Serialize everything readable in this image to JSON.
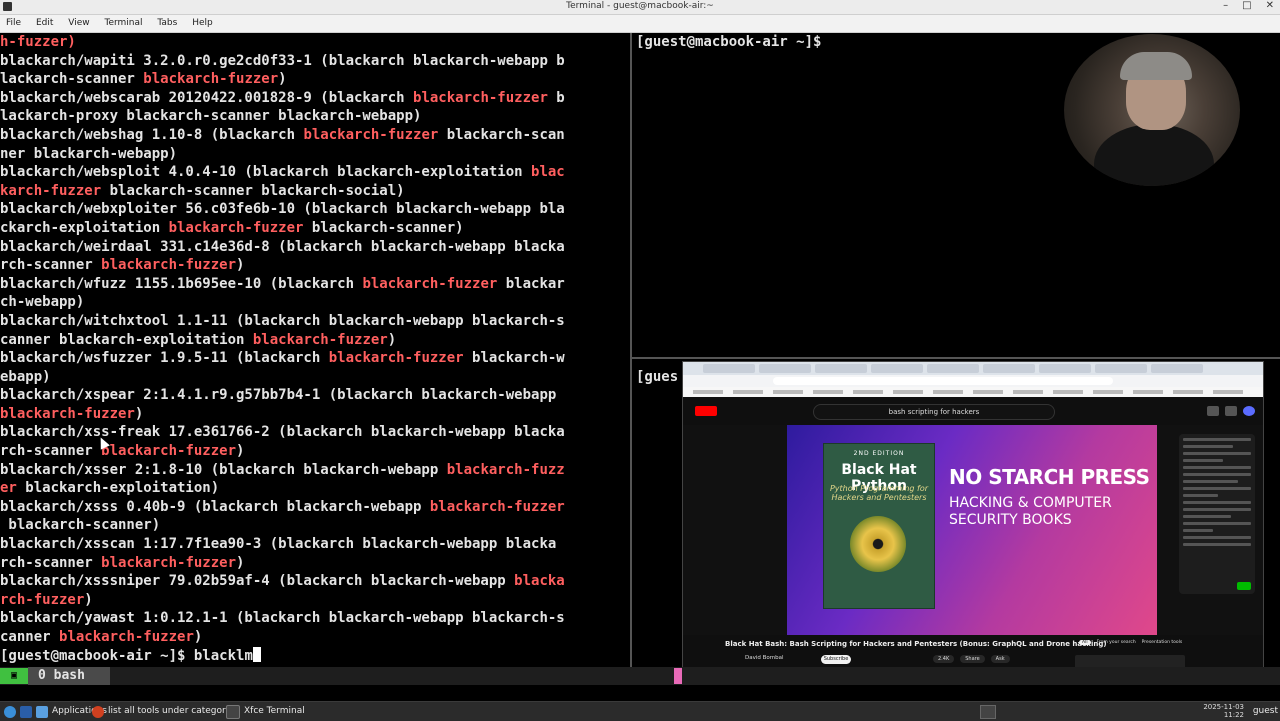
{
  "window": {
    "title": "Terminal - guest@macbook-air:~",
    "minimize": "–",
    "maximize": "□",
    "close": "✕"
  },
  "menu": [
    "File",
    "Edit",
    "View",
    "Terminal",
    "Tabs",
    "Help"
  ],
  "terminal_left": {
    "lines": [
      [
        {
          "t": "h-fuzzer)",
          "c": "r"
        }
      ],
      [
        {
          "t": "blackarch/wapiti 3.2.0.r0.ge2cd0f33-1 (blackarch blackarch-webapp b"
        }
      ],
      [
        {
          "t": "lackarch-scanner "
        },
        {
          "t": "blackarch-fuzzer",
          "c": "r"
        },
        {
          "t": ")"
        }
      ],
      [
        {
          "t": "blackarch/webscarab 20120422.001828-9 (blackarch "
        },
        {
          "t": "blackarch-fuzzer",
          "c": "r"
        },
        {
          "t": " b"
        }
      ],
      [
        {
          "t": "lackarch-proxy blackarch-scanner blackarch-webapp)"
        }
      ],
      [
        {
          "t": "blackarch/webshag 1.10-8 (blackarch "
        },
        {
          "t": "blackarch-fuzzer",
          "c": "r"
        },
        {
          "t": " blackarch-scan"
        }
      ],
      [
        {
          "t": "ner blackarch-webapp)"
        }
      ],
      [
        {
          "t": "blackarch/websploit 4.0.4-10 (blackarch blackarch-exploitation "
        },
        {
          "t": "blac",
          "c": "r"
        }
      ],
      [
        {
          "t": "karch-fuzzer",
          "c": "r"
        },
        {
          "t": " blackarch-scanner blackarch-social)"
        }
      ],
      [
        {
          "t": "blackarch/webxploiter 56.c03fe6b-10 (blackarch blackarch-webapp bla"
        }
      ],
      [
        {
          "t": "ckarch-exploitation "
        },
        {
          "t": "blackarch-fuzzer",
          "c": "r"
        },
        {
          "t": " blackarch-scanner)"
        }
      ],
      [
        {
          "t": "blackarch/weirdaal 331.c14e36d-8 (blackarch blackarch-webapp blacka"
        }
      ],
      [
        {
          "t": "rch-scanner "
        },
        {
          "t": "blackarch-fuzzer",
          "c": "r"
        },
        {
          "t": ")"
        }
      ],
      [
        {
          "t": "blackarch/wfuzz 1155.1b695ee-10 (blackarch "
        },
        {
          "t": "blackarch-fuzzer",
          "c": "r"
        },
        {
          "t": " blackar"
        }
      ],
      [
        {
          "t": "ch-webapp)"
        }
      ],
      [
        {
          "t": "blackarch/witchxtool 1.1-11 (blackarch blackarch-webapp blackarch-s"
        }
      ],
      [
        {
          "t": "canner blackarch-exploitation "
        },
        {
          "t": "blackarch-fuzzer",
          "c": "r"
        },
        {
          "t": ")"
        }
      ],
      [
        {
          "t": "blackarch/wsfuzzer 1.9.5-11 (blackarch "
        },
        {
          "t": "blackarch-fuzzer",
          "c": "r"
        },
        {
          "t": " blackarch-w"
        }
      ],
      [
        {
          "t": "ebapp)"
        }
      ],
      [
        {
          "t": "blackarch/xspear 2:1.4.1.r9.g57bb7b4-1 (blackarch blackarch-webapp"
        }
      ],
      [
        {
          "t": "blackarch-fuzzer",
          "c": "r"
        },
        {
          "t": ")"
        }
      ],
      [
        {
          "t": "blackarch/xss-freak 17.e361766-2 (blackarch blackarch-webapp blacka"
        }
      ],
      [
        {
          "t": "rch-scanner "
        },
        {
          "t": "blackarch-fuzzer",
          "c": "r"
        },
        {
          "t": ")"
        }
      ],
      [
        {
          "t": "blackarch/xsser 2:1.8-10 (blackarch blackarch-webapp "
        },
        {
          "t": "blackarch-fuzz",
          "c": "r"
        }
      ],
      [
        {
          "t": "er",
          "c": "r"
        },
        {
          "t": " blackarch-exploitation)"
        }
      ],
      [
        {
          "t": "blackarch/xsss 0.40b-9 (blackarch blackarch-webapp "
        },
        {
          "t": "blackarch-fuzzer",
          "c": "r"
        }
      ],
      [
        {
          "t": " blackarch-scanner)"
        }
      ],
      [
        {
          "t": "blackarch/xsscan 1:17.7f1ea90-3 (blackarch blackarch-webapp blacka"
        }
      ],
      [
        {
          "t": "rch-scanner "
        },
        {
          "t": "blackarch-fuzzer",
          "c": "r"
        },
        {
          "t": ")"
        }
      ],
      [
        {
          "t": "blackarch/xsssniper 79.02b59af-4 (blackarch blackarch-webapp "
        },
        {
          "t": "blacka",
          "c": "r"
        }
      ],
      [
        {
          "t": "rch-fuzzer",
          "c": "r"
        },
        {
          "t": ")"
        }
      ],
      [
        {
          "t": "blackarch/yawast 1:0.12.1-1 (blackarch blackarch-webapp blackarch-s"
        }
      ],
      [
        {
          "t": "canner "
        },
        {
          "t": "blackarch-fuzzer",
          "c": "r"
        },
        {
          "t": ")"
        }
      ]
    ],
    "prompt": "[guest@macbook-air ~]$ ",
    "command": "blacklm"
  },
  "terminal_right_top": {
    "prompt": "[guest@macbook-air ~]$"
  },
  "terminal_right_bottom": {
    "prompt": "[gues"
  },
  "youtube_overlay": {
    "search_text": "bash scripting for hackers",
    "book": {
      "edition": "2ND EDITION",
      "title": "Black Hat Python",
      "subtitle": "Python Programming for Hackers and Pentesters"
    },
    "publisher_line1": "NO STARCH PRESS",
    "publisher_line2": "HACKING & COMPUTER",
    "publisher_line3": "SECURITY BOOKS",
    "video_title": "Black Hat Bash: Bash Scripting for Hackers and Pentesters (Bonus: GraphQL and Drone hacking)",
    "channel": "David Bombal",
    "subscribe": "Subscribe",
    "actions": [
      "2.4K",
      "Share",
      "Ask"
    ],
    "chips": [
      "All",
      "From your search",
      "Presentation tools"
    ]
  },
  "tmux": {
    "session_num": "0",
    "window_label": "bash"
  },
  "taskbar": {
    "applications": "Applications",
    "browser_tab": "list all tools under categor",
    "terminal_task": "Xfce Terminal",
    "date": "2025-11-03",
    "time": "11:22",
    "user": "guest"
  },
  "colors": {
    "terminal_bg": "#000000",
    "terminal_fg": "#e4e4e4",
    "highlight_red": "#ff5f5f",
    "tmux_status_green": "#40c040"
  }
}
